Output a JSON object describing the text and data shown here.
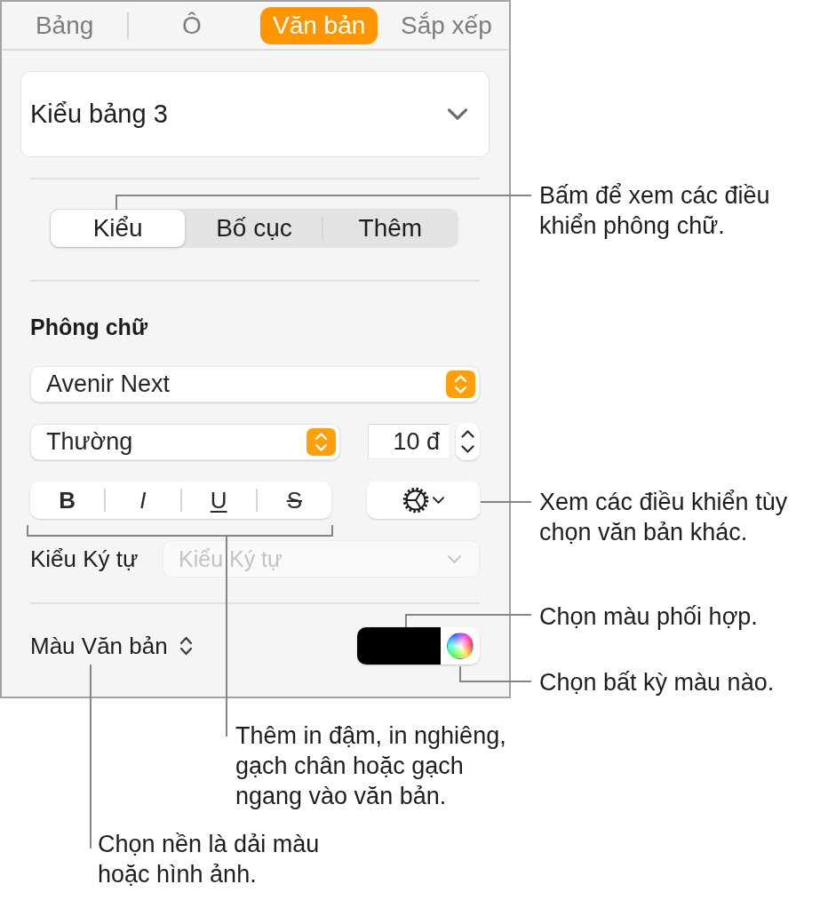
{
  "tabs": [
    {
      "label": "Bảng",
      "selected": false
    },
    {
      "label": "Ô",
      "selected": false
    },
    {
      "label": "Văn bản",
      "selected": true
    },
    {
      "label": "Sắp xếp",
      "selected": false
    }
  ],
  "table_style": {
    "value": "Kiểu bảng 3"
  },
  "segments": [
    {
      "label": "Kiểu",
      "selected": true
    },
    {
      "label": "Bố cục",
      "selected": false
    },
    {
      "label": "Thêm",
      "selected": false
    }
  ],
  "font": {
    "heading": "Phông chữ",
    "family": "Avenir Next",
    "typeface": "Thường",
    "size": "10 đ",
    "styles": [
      {
        "kind": "bold",
        "label": "B"
      },
      {
        "kind": "italic",
        "label": "I"
      },
      {
        "kind": "underline",
        "label": "U"
      },
      {
        "kind": "strikethrough",
        "label": "S"
      }
    ]
  },
  "character_style": {
    "label": "Kiểu Ký tự",
    "value": "Kiểu Ký tự",
    "disabled": true
  },
  "text_color": {
    "label": "Màu Văn bản",
    "color": "#000000"
  },
  "callouts": [
    {
      "lines": [
        "Bấm để xem các điều",
        "khiển phông chữ."
      ]
    },
    {
      "lines": [
        "Xem các điều khiển tùy",
        "chọn văn bản khác."
      ]
    },
    {
      "lines": [
        "Chọn màu phối hợp."
      ]
    },
    {
      "lines": [
        "Chọn bất kỳ màu nào."
      ]
    },
    {
      "lines": [
        "Thêm in đậm, in nghiêng,",
        "gạch chân hoặc gạch",
        "ngang vào văn bản."
      ]
    },
    {
      "lines": [
        "Chọn nền là dải màu",
        "hoặc hình ảnh."
      ]
    }
  ]
}
